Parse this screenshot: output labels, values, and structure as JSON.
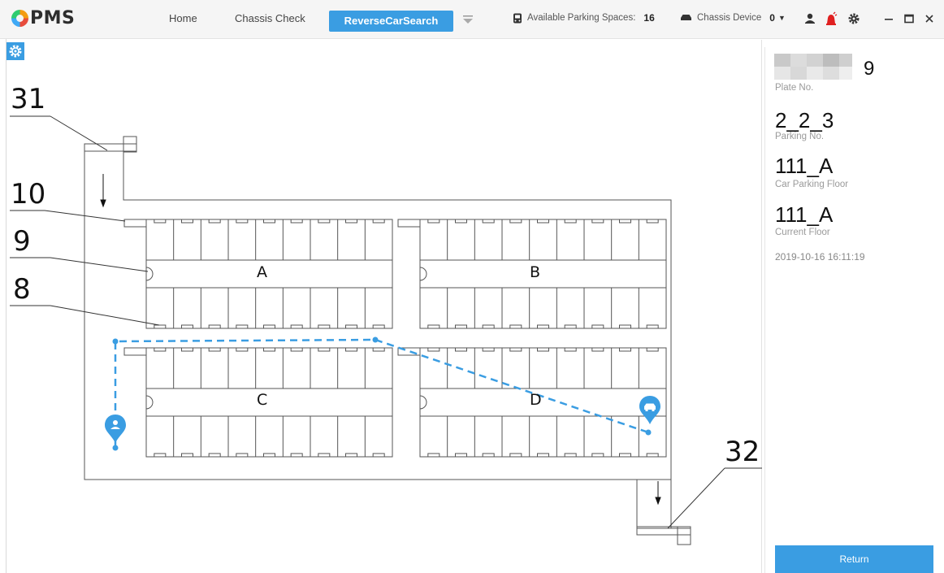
{
  "app": {
    "logo_text": "PMS"
  },
  "nav": {
    "home": "Home",
    "chassis_check": "Chassis Check",
    "active_tab": "ReverseCarSearch"
  },
  "status": {
    "parking_label": "Available Parking Spaces:",
    "parking_value": "16",
    "device_label": "Chassis Device",
    "device_value": "0"
  },
  "icons": [
    "logo-icon",
    "expand-tabs-icon",
    "parking-icon",
    "car-icon",
    "user-icon",
    "alarm-icon",
    "gear-icon",
    "minimize-icon",
    "maximize-icon",
    "close-icon",
    "settings-gear-icon",
    "person-pin-icon",
    "car-pin-icon"
  ],
  "map": {
    "callouts": [
      "31",
      "10",
      "9",
      "8",
      "32"
    ],
    "zones": [
      "A",
      "B",
      "C",
      "D"
    ]
  },
  "panel": {
    "plate_suffix": "9",
    "plate_label": "Plate No.",
    "parking_no": "2_2_3",
    "parking_label": "Parking No.",
    "car_floor": "111_A",
    "car_floor_label": "Car Parking Floor",
    "current_floor": "111_A",
    "current_floor_label": "Current Floor",
    "timestamp": "2019-10-16 16:11:19",
    "return_label": "Return"
  },
  "colors": {
    "accent": "#3a9de2",
    "route": "#3a9de2",
    "map_line": "#555555"
  }
}
